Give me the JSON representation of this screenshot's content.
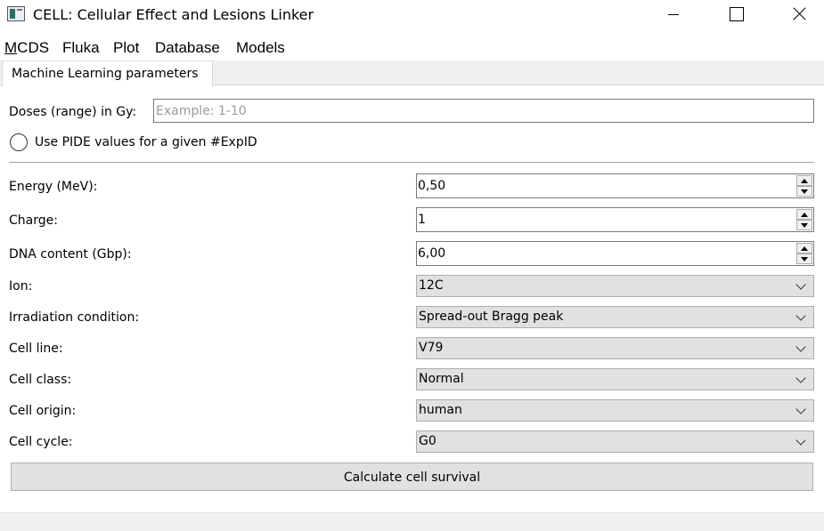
{
  "window": {
    "title": "CELL: Cellular Effect and Lesions Linker",
    "icon": "app-window-icon",
    "controls": [
      "minimize-icon",
      "maximize-icon",
      "close-icon"
    ]
  },
  "menubar": {
    "mcds_mnemonic": "M",
    "mcds_rest": "CDS",
    "fluka": "Fluka",
    "plot": "Plot",
    "database": "Database",
    "models": "Models"
  },
  "tabs": [
    {
      "label": "Machine Learning parameters",
      "active": true
    }
  ],
  "form": {
    "doses_label": "Doses (range) in Gy:",
    "doses_value": "",
    "doses_placeholder": "Example: 1-10",
    "pide_radio_label": "Use PIDE values for a given #ExpID",
    "pide_radio_checked": false,
    "energy": {
      "label": "Energy (MeV):",
      "value": "0,50"
    },
    "charge": {
      "label": "Charge:",
      "value": "1"
    },
    "dna": {
      "label": "DNA content (Gbp):",
      "value": "6,00"
    },
    "ion": {
      "label": "Ion:",
      "value": "12C"
    },
    "irradiation": {
      "label": "Irradiation condition:",
      "value": "Spread-out Bragg peak"
    },
    "cell_line": {
      "label": "Cell line:",
      "value": "V79"
    },
    "cell_class": {
      "label": "Cell class:",
      "value": "Normal"
    },
    "cell_origin": {
      "label": "Cell origin:",
      "value": "human"
    },
    "cell_cycle": {
      "label": "Cell cycle:",
      "value": "G0"
    }
  },
  "actions": {
    "calculate_label": "Calculate cell survival"
  },
  "colors": {
    "chrome_bg": "#f0f0f0",
    "control_bg": "#e1e1e1",
    "border": "#adadad"
  }
}
